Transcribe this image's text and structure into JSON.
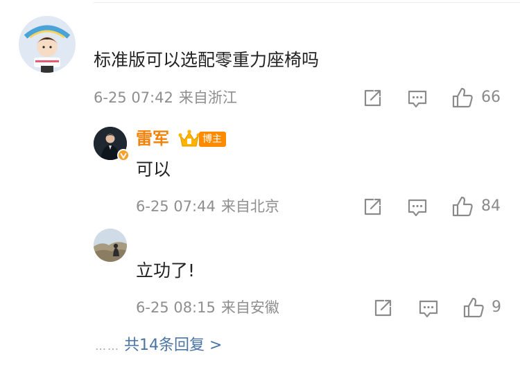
{
  "comment": {
    "text": "标准版可以选配零重力座椅吗",
    "date": "6-25 07:42",
    "location": "来自浙江",
    "likes": "66"
  },
  "replies": [
    {
      "author": "雷军",
      "badge": "博主",
      "text": "可以",
      "date": "6-25 07:44",
      "location": "来自北京",
      "likes": "84"
    },
    {
      "text": "立功了!",
      "date": "6-25 08:15",
      "location": "来自安徽",
      "likes": "9"
    }
  ],
  "more_replies": {
    "dots": "……",
    "label": "共14条回复 >"
  },
  "icons": [
    "share-icon",
    "comment-icon",
    "like-icon",
    "crown-icon",
    "verified-icon"
  ],
  "colors": {
    "author_name": "#f0830b",
    "badge_bg": "#ff8a00",
    "link": "#4a73a6",
    "meta": "#8e8e8e"
  }
}
